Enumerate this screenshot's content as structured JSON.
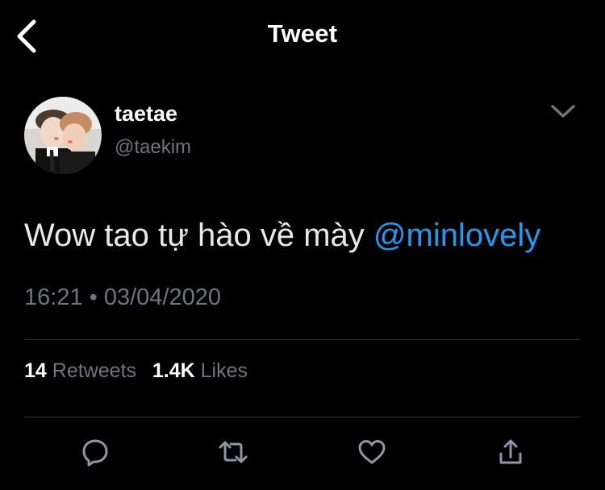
{
  "header": {
    "title": "Tweet",
    "back_icon": "chevron-left-icon"
  },
  "author": {
    "display_name": "taetae",
    "handle": "@taekim",
    "avatar": "avatar-photo",
    "menu_icon": "chevron-down-icon"
  },
  "tweet": {
    "text": "Wow tao tự hào về mày",
    "mention": "@minlovely",
    "time": "16:21",
    "separator": "•",
    "date": "03/04/2020"
  },
  "stats": {
    "retweets_count": "14",
    "retweets_label": "Retweets",
    "likes_count": "1.4K",
    "likes_label": "Likes"
  },
  "actions": [
    {
      "name": "reply",
      "icon": "reply-icon"
    },
    {
      "name": "retweet",
      "icon": "retweet-icon"
    },
    {
      "name": "like",
      "icon": "heart-icon"
    },
    {
      "name": "share",
      "icon": "share-icon"
    }
  ],
  "colors": {
    "background": "#000000",
    "text": "#ffffff",
    "secondary": "#6e767d",
    "link": "#1d9bf0",
    "divider": "#2f3336"
  }
}
